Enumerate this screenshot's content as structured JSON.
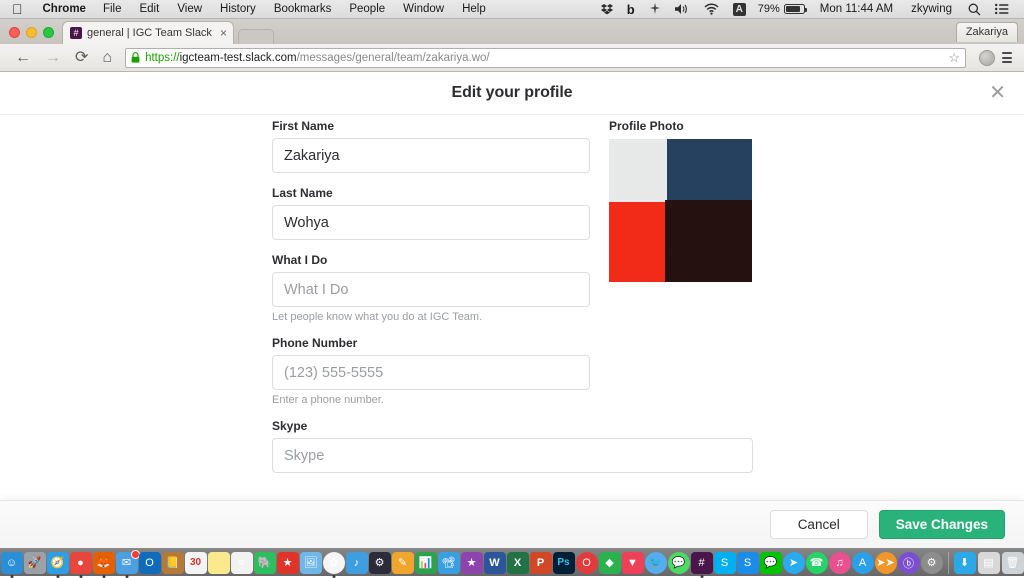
{
  "os_menubar": {
    "apple_icon": "apple-logo",
    "items": [
      "Chrome",
      "File",
      "Edit",
      "View",
      "History",
      "Bookmarks",
      "People",
      "Window",
      "Help"
    ],
    "status_icons": [
      "dropbox-icon",
      "backblaze-icon",
      "shuttle-icon",
      "volume-icon",
      "wifi-icon",
      "input-source-icon"
    ],
    "input_source": "A",
    "battery_percent": "79%",
    "clock": "Mon 11:44 AM",
    "user": "zkywing",
    "spotlight_icon": "search-icon",
    "notification_icon": "notification-center-icon"
  },
  "browser": {
    "window_controls": [
      "close",
      "minimize",
      "zoom"
    ],
    "tab": {
      "favicon": "slack-hash-icon",
      "title": "general | IGC Team Slack",
      "close_icon": "close-icon"
    },
    "new_tab_label": "",
    "profile_chip": "Zakariya",
    "toolbar": {
      "back_icon": "back-arrow-icon",
      "forward_icon": "forward-arrow-icon",
      "reload_icon": "reload-icon",
      "home_icon": "home-icon",
      "lock_icon": "secure-lock-icon",
      "url_scheme": "https://",
      "url_host": "igcteam-test.slack.com",
      "url_path": "/messages/general/team/zakariya.wo/",
      "bookmark_icon": "star-icon",
      "extension_icon": "extension-icon",
      "menu_icon": "hamburger-menu-icon"
    }
  },
  "modal": {
    "title": "Edit your profile",
    "close_icon": "close-icon",
    "fields": [
      {
        "key": "first_name",
        "label": "First Name",
        "value": "Zakariya",
        "placeholder": "First Name",
        "hint": ""
      },
      {
        "key": "last_name",
        "label": "Last Name",
        "value": "Wohya",
        "placeholder": "Last Name",
        "hint": ""
      },
      {
        "key": "what_i_do",
        "label": "What I Do",
        "value": "",
        "placeholder": "What I Do",
        "hint": "Let people know what you do at IGC Team."
      },
      {
        "key": "phone_number",
        "label": "Phone Number",
        "value": "",
        "placeholder": "(123) 555-5555",
        "hint": "Enter a phone number."
      },
      {
        "key": "skype",
        "label": "Skype",
        "value": "",
        "placeholder": "Skype",
        "hint": ""
      }
    ],
    "photo": {
      "label": "Profile Photo",
      "alt": "profile-photo-thumbnail",
      "colors": {
        "top_left": "#e9eaea",
        "top_right": "#24405e",
        "bottom_left": "#f32a17",
        "bottom_right": "#24100e"
      }
    },
    "footer": {
      "cancel_label": "Cancel",
      "save_label": "Save Changes",
      "save_color": "#2ab27b"
    }
  },
  "dock": {
    "items": [
      {
        "name": "finder",
        "color": "#2a8fd6",
        "glyph": "☺"
      },
      {
        "name": "launchpad",
        "color": "#9aa2a8",
        "glyph": "🚀"
      },
      {
        "name": "safari",
        "color": "#2f9fe5",
        "glyph": "🧭"
      },
      {
        "name": "chrome",
        "color": "#e8453c",
        "glyph": "●"
      },
      {
        "name": "firefox",
        "color": "#e66000",
        "glyph": "🦊"
      },
      {
        "name": "mail",
        "color": "#4c9fe0",
        "glyph": "✉"
      },
      {
        "name": "outlook",
        "color": "#0f6cbd",
        "glyph": "O"
      },
      {
        "name": "address-book",
        "color": "#b5793a",
        "glyph": "📒"
      },
      {
        "name": "calendar",
        "color": "#f4f4f4",
        "glyph": "30"
      },
      {
        "name": "notes",
        "color": "#fbe98d",
        "glyph": ""
      },
      {
        "name": "reminders",
        "color": "#f2f2f2",
        "glyph": "≡"
      },
      {
        "name": "evernote",
        "color": "#2dbe60",
        "glyph": "🐘"
      },
      {
        "name": "bookmarks",
        "color": "#e0342b",
        "glyph": "★"
      },
      {
        "name": "preview",
        "color": "#6fb7e8",
        "glyph": "🖼"
      },
      {
        "name": "photos",
        "color": "#f5f5f5",
        "glyph": "✿"
      },
      {
        "name": "itunes-alt",
        "color": "#3f9ee0",
        "glyph": "♪"
      },
      {
        "name": "steam",
        "color": "#2b2b3a",
        "glyph": "⚙"
      },
      {
        "name": "pages",
        "color": "#f0a52c",
        "glyph": "✎"
      },
      {
        "name": "numbers",
        "color": "#2ca24a",
        "glyph": "📊"
      },
      {
        "name": "keynote",
        "color": "#3a9fe0",
        "glyph": "📽"
      },
      {
        "name": "imovie",
        "color": "#8e44ad",
        "glyph": "★"
      },
      {
        "name": "word",
        "color": "#2b579a",
        "glyph": "W"
      },
      {
        "name": "excel",
        "color": "#217346",
        "glyph": "X"
      },
      {
        "name": "powerpoint",
        "color": "#d24726",
        "glyph": "P"
      },
      {
        "name": "photoshop",
        "color": "#001e36",
        "glyph": "Ps"
      },
      {
        "name": "opera",
        "color": "#e33b3b",
        "glyph": "O"
      },
      {
        "name": "feedly",
        "color": "#2bb24c",
        "glyph": "◆"
      },
      {
        "name": "pocket",
        "color": "#ee4056",
        "glyph": "▼"
      },
      {
        "name": "twitter-app",
        "color": "#55acee",
        "glyph": "🐦"
      },
      {
        "name": "sms",
        "color": "#4cd964",
        "glyph": "💬"
      },
      {
        "name": "slack",
        "color": "#4a154b",
        "glyph": "#"
      },
      {
        "name": "skype",
        "color": "#00aff0",
        "glyph": "S"
      },
      {
        "name": "shazam",
        "color": "#1b8de8",
        "glyph": "S"
      },
      {
        "name": "line",
        "color": "#00c300",
        "glyph": "💬"
      },
      {
        "name": "telegram",
        "color": "#2aabee",
        "glyph": "➤"
      },
      {
        "name": "whatsapp",
        "color": "#25d366",
        "glyph": "☎"
      },
      {
        "name": "itunes",
        "color": "#e8508f",
        "glyph": "♫"
      },
      {
        "name": "app-store",
        "color": "#2b9fe8",
        "glyph": "A"
      },
      {
        "name": "fast-forward",
        "color": "#f0962a",
        "glyph": "➤➤"
      },
      {
        "name": "bittorrent",
        "color": "#7a4fd0",
        "glyph": "ⓑ"
      },
      {
        "name": "system-preferences",
        "color": "#8d8d8d",
        "glyph": "⚙"
      }
    ],
    "right_items": [
      {
        "name": "downloads-folder",
        "color": "#2aa8e8",
        "glyph": "⬇"
      },
      {
        "name": "documents-stack",
        "color": "#d8d8d8",
        "glyph": "▤"
      },
      {
        "name": "trash",
        "color": "#cfd3d6",
        "glyph": "🗑"
      }
    ]
  }
}
